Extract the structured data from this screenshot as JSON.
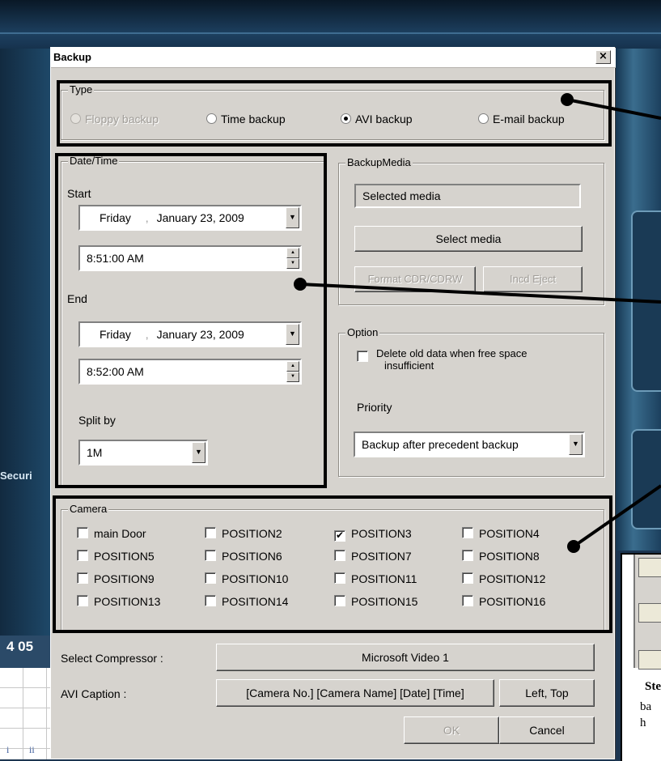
{
  "background": {
    "logo_fragment": "Securi",
    "date_fragment": "4  05",
    "grid_labels": [
      "i",
      "ii"
    ],
    "doc_fragment_line1": "Ste",
    "doc_fragment_line2": "ba",
    "doc_fragment_line3": "h"
  },
  "dialog": {
    "title": "Backup",
    "close_glyph": "×"
  },
  "type_group": {
    "label": "Type",
    "options": [
      {
        "label": "Floppy backup",
        "selected": false,
        "enabled": false
      },
      {
        "label": "Time backup",
        "selected": false,
        "enabled": true
      },
      {
        "label": "AVI backup",
        "selected": true,
        "enabled": true
      },
      {
        "label": "E-mail backup",
        "selected": false,
        "enabled": true
      }
    ]
  },
  "datetime_group": {
    "label": "Date/Time",
    "start_label": "Start",
    "start_day": "Friday",
    "start_date": "January  23, 2009",
    "start_time": "8:51:00 AM",
    "end_label": "End",
    "end_day": "Friday",
    "end_date": "January  23, 2009",
    "end_time": "8:52:00 AM",
    "split_label": "Split by",
    "split_value": "1M"
  },
  "backup_media_group": {
    "label": "BackupMedia",
    "selected_media": "Selected media",
    "select_media_button": "Select media",
    "format_button": "Format CDR/CDRW",
    "eject_button": "Incd Eject"
  },
  "option_group": {
    "label": "Option",
    "delete_old_line1": "Delete old data when free space",
    "delete_old_line2": "insufficient",
    "delete_old_checked": false,
    "priority_label": "Priority",
    "priority_value": "Backup after precedent backup"
  },
  "camera_group": {
    "label": "Camera",
    "cameras": [
      {
        "label": "main Door",
        "checked": false
      },
      {
        "label": "POSITION2",
        "checked": false
      },
      {
        "label": "POSITION3",
        "checked": true
      },
      {
        "label": "POSITION4",
        "checked": false
      },
      {
        "label": "POSITION5",
        "checked": false
      },
      {
        "label": "POSITION6",
        "checked": false
      },
      {
        "label": "POSITION7",
        "checked": false
      },
      {
        "label": "POSITION8",
        "checked": false
      },
      {
        "label": "POSITION9",
        "checked": false
      },
      {
        "label": "POSITION10",
        "checked": false
      },
      {
        "label": "POSITION11",
        "checked": false
      },
      {
        "label": "POSITION12",
        "checked": false
      },
      {
        "label": "POSITION13",
        "checked": false
      },
      {
        "label": "POSITION14",
        "checked": false
      },
      {
        "label": "POSITION15",
        "checked": false
      },
      {
        "label": "POSITION16",
        "checked": false
      }
    ]
  },
  "compressor": {
    "label": "Select Compressor :",
    "value": "Microsoft Video 1"
  },
  "caption": {
    "label": "AVI Caption :",
    "value": "[Camera No.] [Camera Name] [Date] [Time]",
    "position_button": "Left, Top"
  },
  "footer": {
    "ok_label": "OK",
    "cancel_label": "Cancel"
  }
}
